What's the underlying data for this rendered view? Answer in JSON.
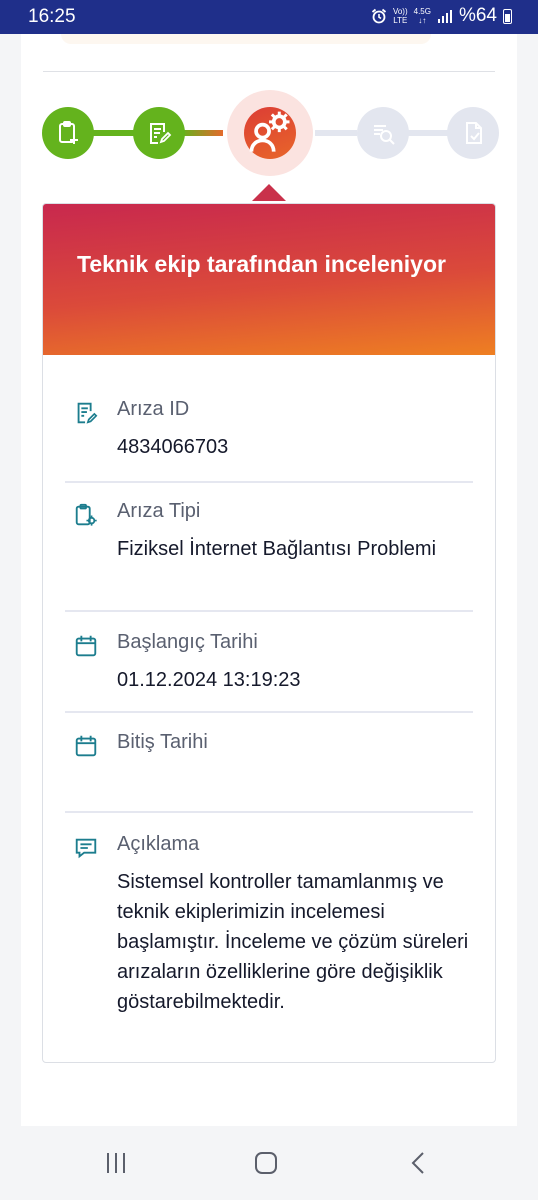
{
  "status_bar": {
    "time": "16:25",
    "volte_top": "Vo))",
    "volte_bottom": "LTE",
    "network_top": "4.5G",
    "network_bottom": "↓↑",
    "battery_text": "%64"
  },
  "stepper": {
    "steps": [
      {
        "state": "done",
        "icon": "clipboard-add-icon"
      },
      {
        "state": "done",
        "icon": "document-edit-icon"
      },
      {
        "state": "active",
        "icon": "person-gear-icon"
      },
      {
        "state": "todo",
        "icon": "list-search-icon"
      },
      {
        "state": "todo",
        "icon": "document-check-icon"
      }
    ],
    "colors": {
      "done": "#64b31d",
      "todo": "#e3e6ef",
      "active": "#dc3d35"
    }
  },
  "card": {
    "title": "Teknik ekip tarafından inceleniyor",
    "fields": [
      {
        "label": "Arıza ID",
        "value": "4834066703",
        "icon": "document-edit-icon"
      },
      {
        "label": "Arıza Tipi",
        "value": "Fiziksel İnternet Bağlantısı Problemi",
        "icon": "clipboard-gear-icon"
      },
      {
        "label": "Başlangıç Tarihi",
        "value": "01.12.2024 13:19:23",
        "icon": "calendar-icon"
      },
      {
        "label": "Bitiş Tarihi",
        "value": "",
        "icon": "calendar-icon"
      },
      {
        "label": "Açıklama",
        "value": "Sistemsel kontroller tamamlanmış ve teknik ekiplerimizin incelemesi başlamıştır. İnceleme ve çözüm süreleri arızaların özelliklerine göre değişiklik göstarebilmektedir.",
        "icon": "message-icon"
      }
    ]
  },
  "nav": {
    "recent": "recent-apps-icon",
    "home": "home-icon",
    "back": "back-icon"
  }
}
